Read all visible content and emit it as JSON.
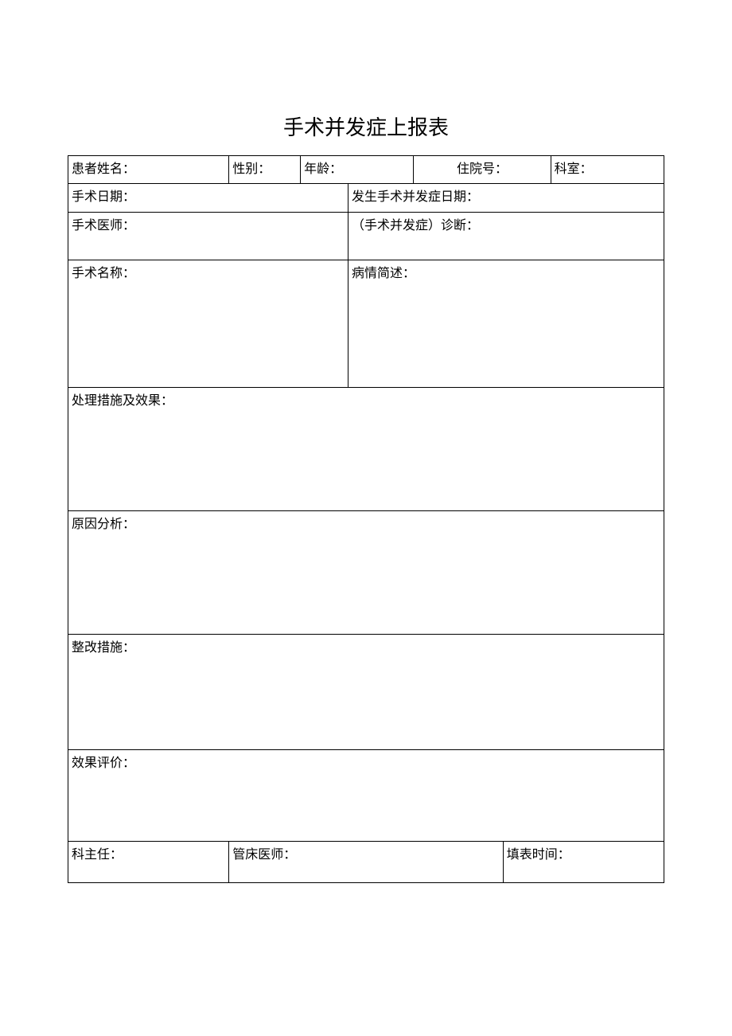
{
  "title": "手术并发症上报表",
  "row1": {
    "patient_name": "患者姓名：",
    "gender": "性别：",
    "age": "年龄：",
    "hospital_no": "住院号：",
    "department": "科室："
  },
  "row2": {
    "surgery_date": "手术日期：",
    "complication_date": "发生手术并发症日期："
  },
  "row3": {
    "surgeon": "手术医师：",
    "diagnosis": "（手术并发症）诊断："
  },
  "row4": {
    "surgery_name": "手术名称：",
    "condition_summary": "病情简述："
  },
  "row5": {
    "measures_effects": "处理措施及效果："
  },
  "row6": {
    "cause_analysis": "原因分析："
  },
  "row7": {
    "corrective_actions": "整改措施："
  },
  "row8": {
    "effect_evaluation": "效果评价："
  },
  "row9": {
    "dept_director": "科主任：",
    "attending_physician": "管床医师：",
    "form_date": "填表时间："
  }
}
